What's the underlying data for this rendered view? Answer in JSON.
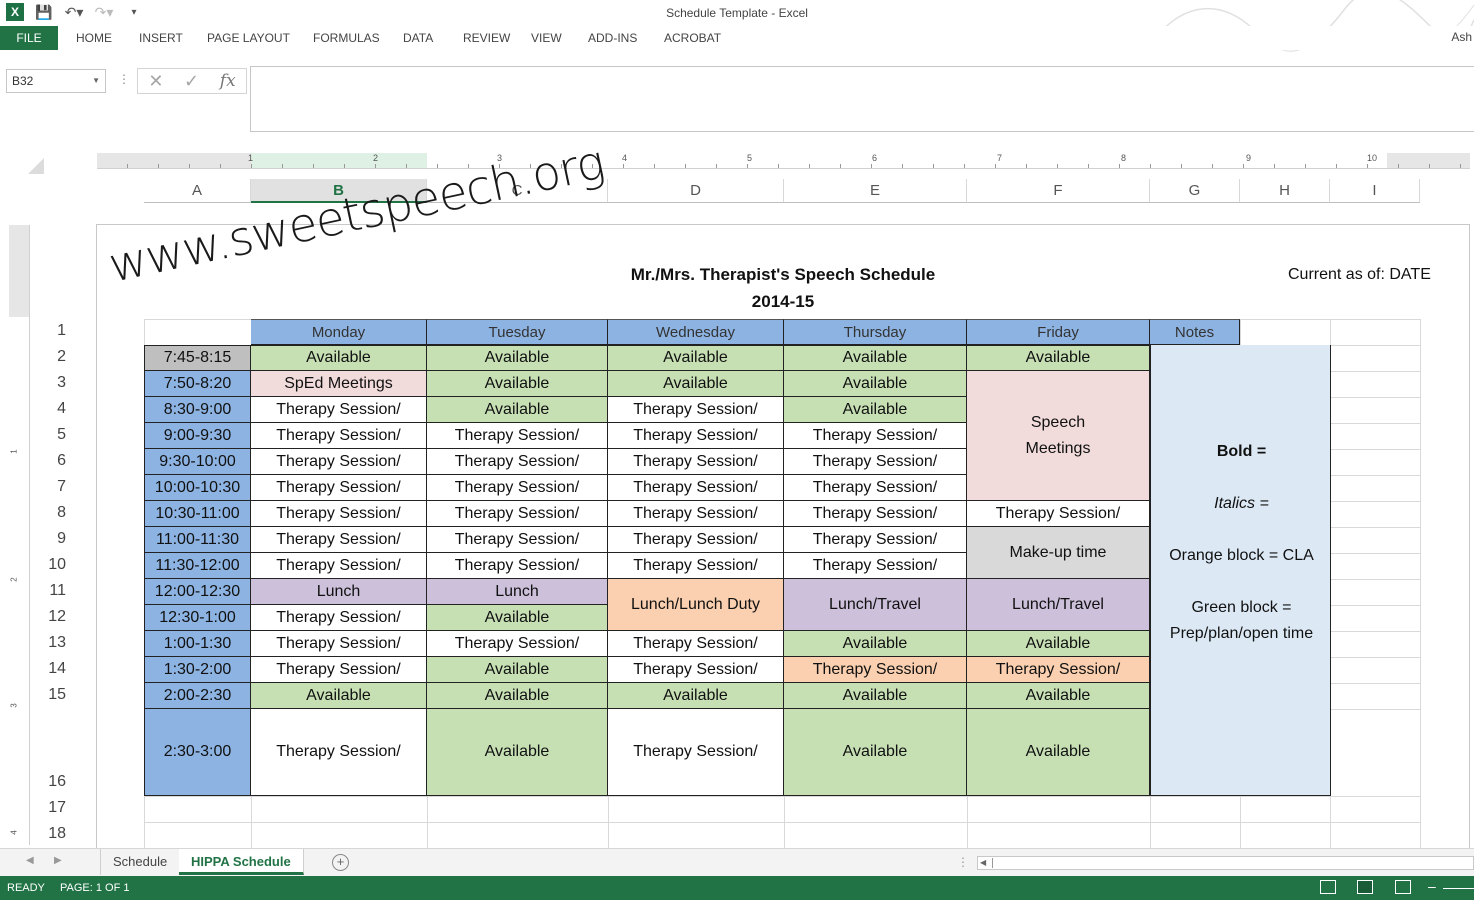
{
  "window": {
    "title": "Schedule Template - Excel",
    "user": "Ash"
  },
  "ribbon": {
    "tabs": [
      "FILE",
      "HOME",
      "INSERT",
      "PAGE LAYOUT",
      "FORMULAS",
      "DATA",
      "REVIEW",
      "VIEW",
      "ADD-INS",
      "ACROBAT"
    ]
  },
  "formula_bar": {
    "name_box": "B32",
    "fx": "fx",
    "value": ""
  },
  "columns": [
    "A",
    "B",
    "C",
    "D",
    "E",
    "F",
    "G",
    "H",
    "I"
  ],
  "selected_column": "B",
  "ruler_numbers": [
    "1",
    "2",
    "3",
    "4",
    "5",
    "6",
    "7",
    "8",
    "9",
    "10"
  ],
  "vruler_numbers": [
    "1",
    "2",
    "3",
    "4"
  ],
  "rows": [
    "1",
    "2",
    "3",
    "4",
    "5",
    "6",
    "7",
    "8",
    "9",
    "10",
    "11",
    "12",
    "13",
    "14",
    "15",
    "16",
    "17",
    "18"
  ],
  "sheet": {
    "title": "Mr./Mrs. Therapist's Speech Schedule",
    "year": "2014-15",
    "current_as_of": "Current as of: DATE",
    "days": [
      "Monday",
      "Tuesday",
      "Wednesday",
      "Thursday",
      "Friday"
    ],
    "notes_header": "Notes",
    "times": [
      "7:45-8:15",
      "7:50-8:20",
      "8:30-9:00",
      "9:00-9:30",
      "9:30-10:00",
      "10:00-10:30",
      "10:30-11:00",
      "11:00-11:30",
      "11:30-12:00",
      "12:00-12:30",
      "12:30-1:00",
      "1:00-1:30",
      "1:30-2:00",
      "2:00-2:30",
      "2:30-3:00"
    ],
    "cells": {
      "mon": [
        "Available",
        "SpEd Meetings",
        "Therapy Session/",
        "Therapy Session/",
        "Therapy Session/",
        "Therapy Session/",
        "Therapy Session/",
        "Therapy Session/",
        "Therapy Session/",
        "Lunch",
        "Therapy Session/",
        "Therapy Session/",
        "Therapy Session/",
        "Available",
        "Therapy Session/"
      ],
      "tue": [
        "Available",
        "Available",
        "Available",
        "Therapy Session/",
        "Therapy Session/",
        "Therapy Session/",
        "Therapy Session/",
        "Therapy Session/",
        "Therapy Session/",
        "Lunch",
        "Available",
        "Therapy Session/",
        "Available",
        "Available",
        "Available"
      ],
      "wed": [
        "Available",
        "Available",
        "Therapy Session/",
        "Therapy Session/",
        "Therapy Session/",
        "Therapy Session/",
        "Therapy Session/",
        "Therapy Session/",
        "Therapy Session/",
        "Lunch/Lunch Duty",
        "Therapy Session/",
        "Therapy Session/",
        "Available",
        "Therapy Session/"
      ],
      "thu": [
        "Available",
        "Available",
        "Available",
        "Therapy Session/",
        "Therapy Session/",
        "Therapy Session/",
        "Therapy Session/",
        "Therapy Session/",
        "Therapy Session/",
        "Lunch/Travel",
        "Available",
        "Therapy Session/",
        "Available",
        "Available"
      ],
      "fri": [
        "Available",
        "Speech Meetings",
        "Therapy Session/",
        "Make-up time",
        "Lunch/Travel",
        "Available",
        "Therapy Session/",
        "Available",
        "Available"
      ]
    },
    "notes": {
      "bold": "Bold =",
      "italics": "Italics =",
      "orange": "Orange block = CLA",
      "green_1": "Green block =",
      "green_2": "Prep/plan/open time"
    }
  },
  "watermark": "www.sweetspeech.org",
  "sheet_tabs": [
    "Schedule",
    "HIPPA Schedule"
  ],
  "active_sheet": "HIPPA Schedule",
  "status": {
    "mode": "READY",
    "page": "PAGE: 1 OF 1"
  },
  "colors": {
    "excel_green": "#217346",
    "header_blue": "#8db3e2",
    "available_green": "#c6e0b4",
    "meeting_pink": "#f2dcdb",
    "lunch_purple": "#ccc0da",
    "cla_orange": "#fad0b0",
    "makeup_gray": "#d9d9d9",
    "notes_blue": "#dce9f5",
    "time_gray": "#bfbfbf"
  }
}
